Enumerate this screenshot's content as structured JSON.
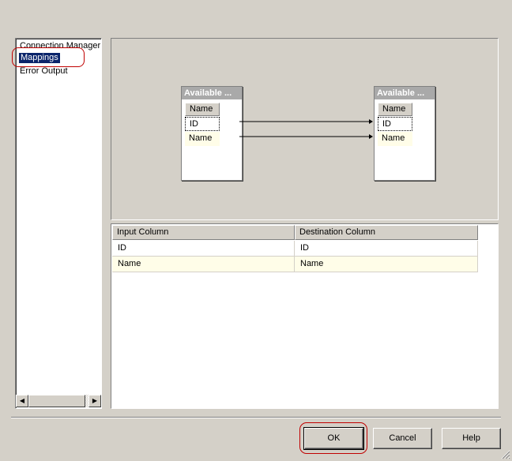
{
  "nav": {
    "items": [
      "Connection Manager",
      "Mappings",
      "Error Output"
    ],
    "selected": "Mappings"
  },
  "diagram": {
    "source": {
      "title": "Available ...",
      "header": "Name",
      "rows": [
        "ID",
        "Name"
      ]
    },
    "destination": {
      "title": "Available ...",
      "header": "Name",
      "rows": [
        "ID",
        "Name"
      ]
    }
  },
  "grid": {
    "columns": [
      "Input Column",
      "Destination Column"
    ],
    "rows": [
      [
        "ID",
        "ID"
      ],
      [
        "Name",
        "Name"
      ]
    ]
  },
  "buttons": {
    "ok": "OK",
    "cancel": "Cancel",
    "help": "Help"
  },
  "colors": {
    "selection": "#0a246a",
    "highlight_annotation": "#c00000",
    "alt_row": "#fffde8"
  }
}
